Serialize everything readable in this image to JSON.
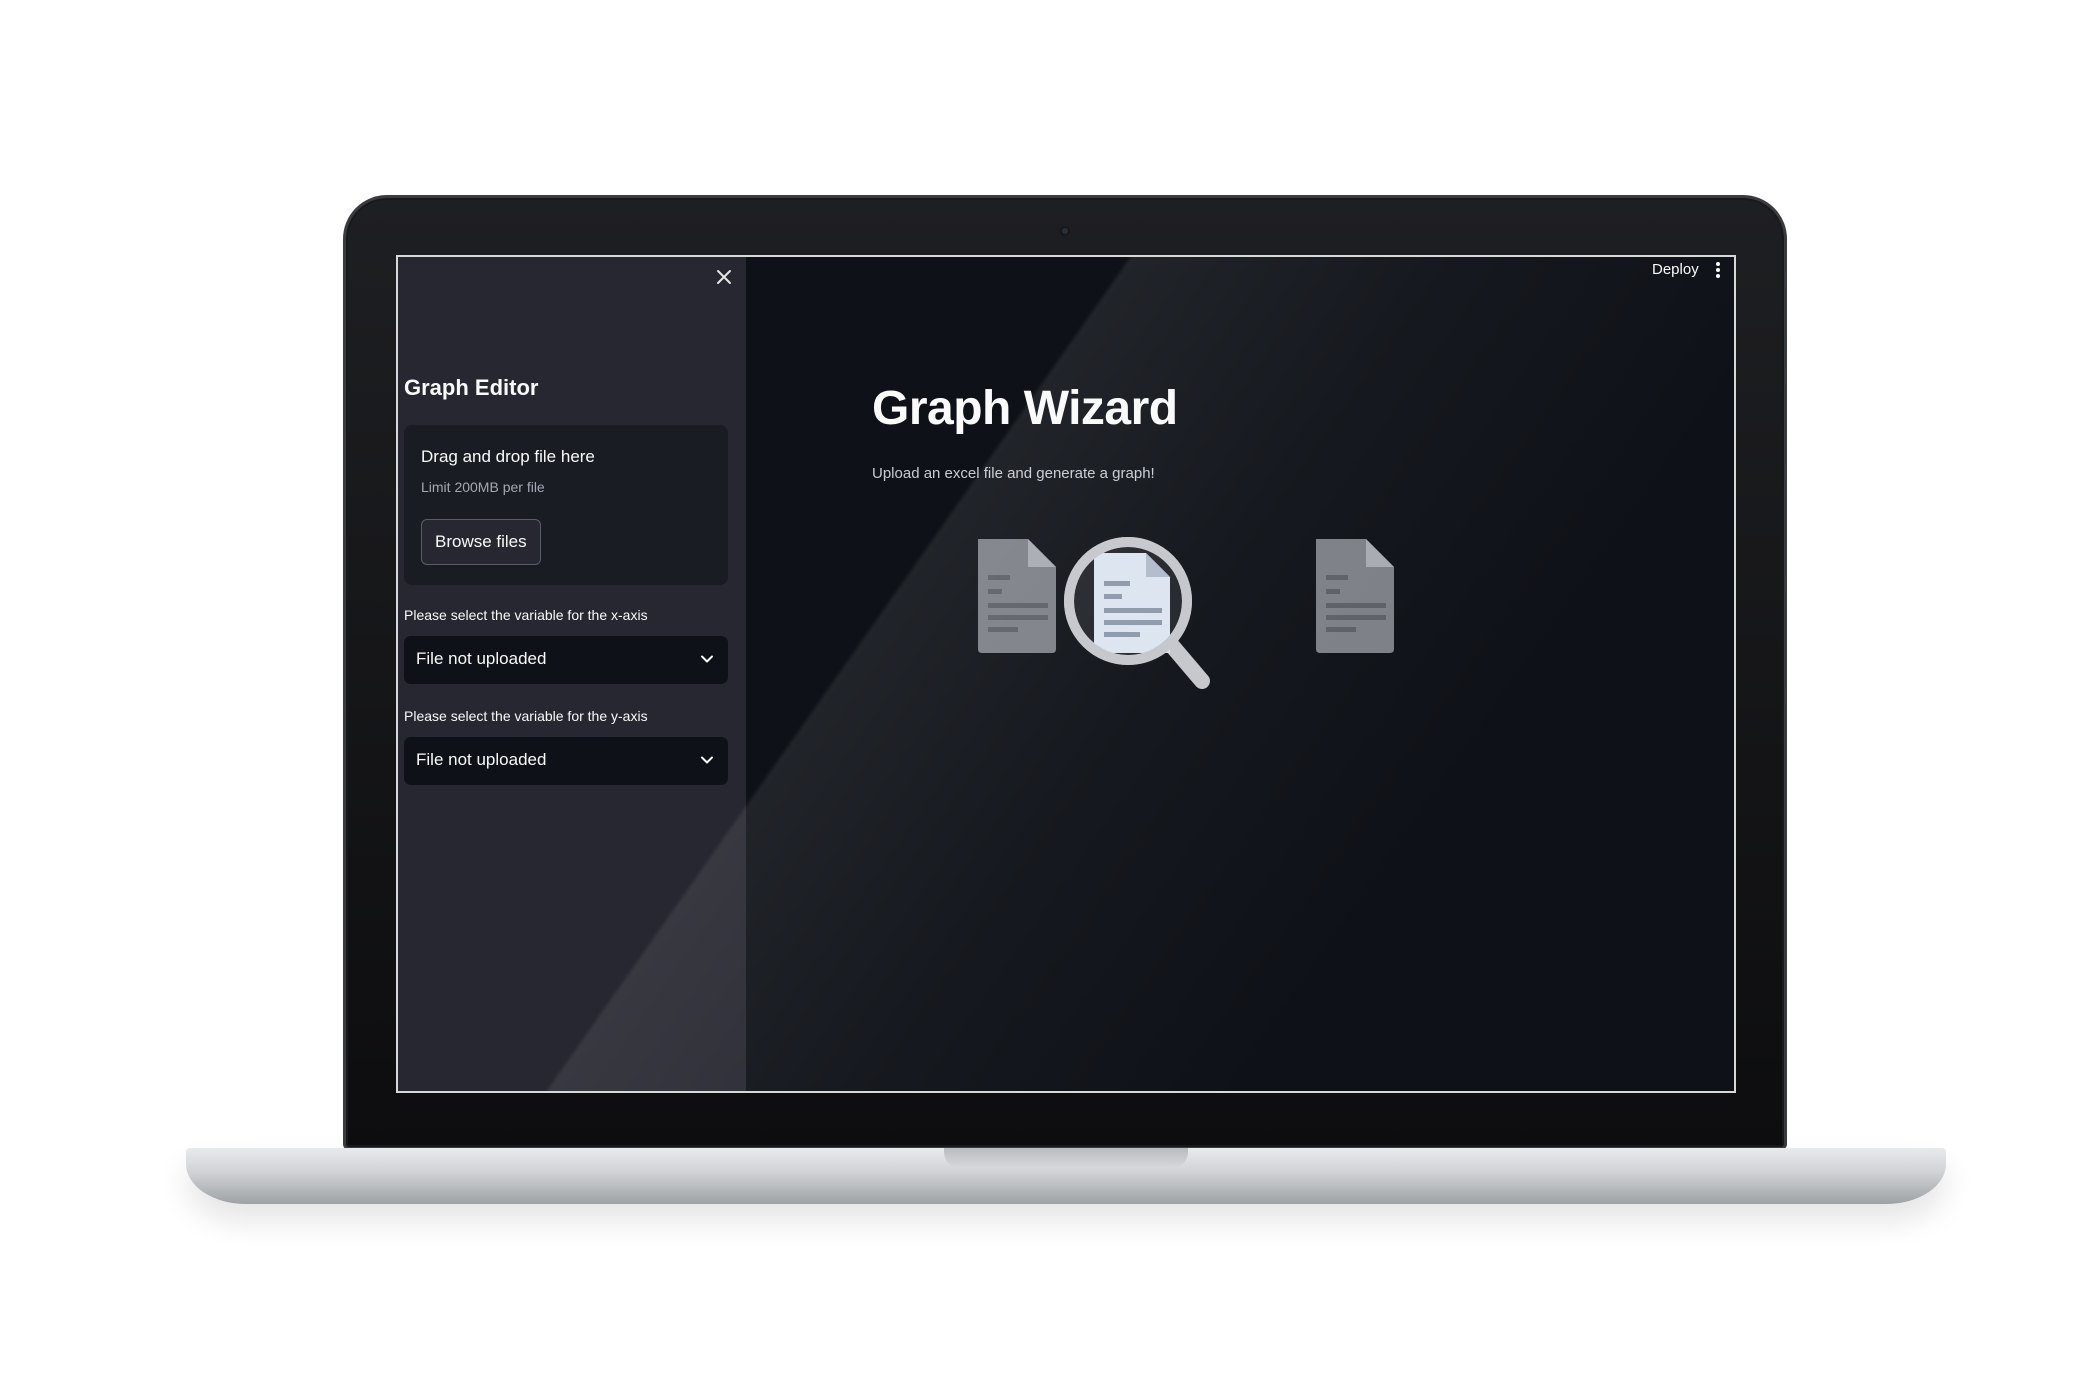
{
  "sidebar": {
    "close_icon": "close-icon",
    "title": "Graph Editor",
    "uploader": {
      "main_text": "Drag and drop file here",
      "limit_text": "Limit 200MB per file",
      "browse_label": "Browse files"
    },
    "x_axis": {
      "label": "Please select the variable for the x-axis",
      "value": "File not uploaded"
    },
    "y_axis": {
      "label": "Please select the variable for the y-axis",
      "value": "File not uploaded"
    }
  },
  "toolbar": {
    "deploy_label": "Deploy",
    "menu_icon": "more-vertical-icon"
  },
  "main": {
    "title": "Graph Wizard",
    "subtitle": "Upload an excel file and generate a graph!",
    "illustration_icons": [
      "document-icon",
      "magnifier-document-icon",
      "document-icon"
    ]
  },
  "colors": {
    "app_background": "#0e1117",
    "sidebar_background": "#262730",
    "text": "#fafafa"
  }
}
